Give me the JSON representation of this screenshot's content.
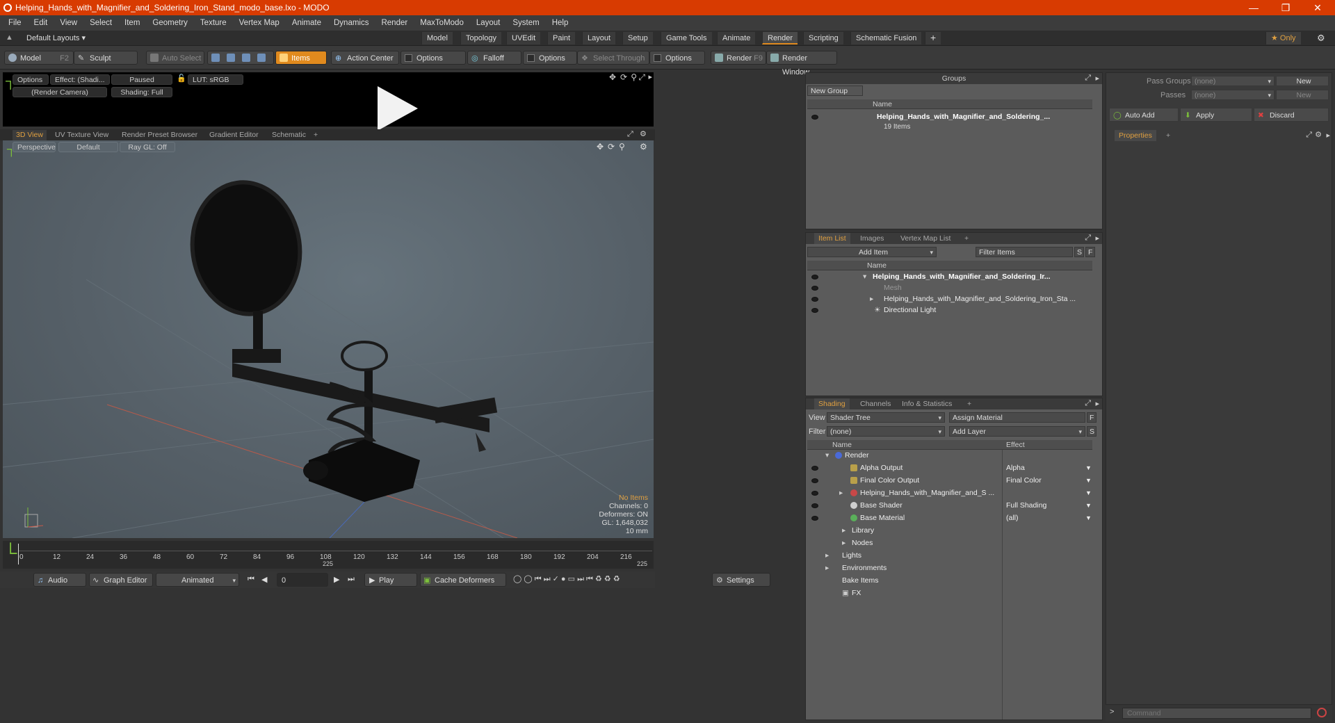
{
  "window": {
    "title": "Helping_Hands_with_Magnifier_and_Soldering_Iron_Stand_modo_base.lxo - MODO"
  },
  "menu": [
    "File",
    "Edit",
    "View",
    "Select",
    "Item",
    "Geometry",
    "Texture",
    "Vertex Map",
    "Animate",
    "Dynamics",
    "Render",
    "MaxToModo",
    "Layout",
    "System",
    "Help"
  ],
  "layouts": {
    "default": "Default Layouts ▾",
    "tabs": [
      "Model",
      "Topology",
      "UVEdit",
      "Paint",
      "Layout",
      "Setup",
      "Game Tools",
      "Animate",
      "Render",
      "Scripting",
      "Schematic Fusion"
    ],
    "active": "Render",
    "plus": "+",
    "only": "★ Only"
  },
  "toolbar": {
    "model": "Model",
    "model_key": "F2",
    "sculpt": "Sculpt",
    "auto_select": "Auto Select",
    "items": "Items",
    "action_center": "Action Center",
    "options1": "Options",
    "falloff": "Falloff",
    "options2": "Options",
    "select_through": "Select Through",
    "options3": "Options",
    "render": "Render",
    "render_key": "F9",
    "render_window": "Render Window"
  },
  "preview": {
    "options": "Options",
    "effect": "Effect: (Shadi...",
    "paused": "Paused",
    "lut": "LUT: sRGB",
    "camera": "(Render Camera)",
    "shading": "Shading: Full"
  },
  "viewport_tabs": [
    "3D View",
    "UV Texture View",
    "Render Preset Browser",
    "Gradient Editor",
    "Schematic",
    "+"
  ],
  "view3d": {
    "perspective": "Perspective",
    "default": "Default",
    "raygl": "Ray GL: Off",
    "hud": {
      "items": "No Items",
      "channels": "Channels: 0",
      "deformers": "Deformers: ON",
      "gl": "GL: 1,648,032",
      "unit": "10 mm"
    }
  },
  "timeline": {
    "ticks": [
      "0",
      "12",
      "24",
      "36",
      "48",
      "60",
      "72",
      "84",
      "96",
      "108",
      "120",
      "132",
      "144",
      "156",
      "168",
      "180",
      "192",
      "204",
      "216"
    ],
    "marker_mid": "225",
    "marker_end": "225"
  },
  "bottom": {
    "audio": "Audio",
    "graph_editor": "Graph Editor",
    "animated": "Animated",
    "frame": "0",
    "play": "Play",
    "cache": "Cache Deformers",
    "settings": "Settings"
  },
  "groups": {
    "title": "Groups",
    "new_group": "New Group",
    "col_name": "Name",
    "item_name": "Helping_Hands_with_Magnifier_and_Soldering_...",
    "item_count": "19 Items"
  },
  "itemlist": {
    "tabs": [
      "Item List",
      "Images",
      "Vertex Map List",
      "+"
    ],
    "add_item": "Add Item",
    "filter": "Filter Items",
    "s": "S",
    "f": "F",
    "col_name": "Name",
    "rows": [
      "Helping_Hands_with_Magnifier_and_Soldering_Ir...",
      "Mesh",
      "Helping_Hands_with_Magnifier_and_Soldering_Iron_Sta ...",
      "Directional Light"
    ]
  },
  "shading": {
    "tabs": [
      "Shading",
      "Channels",
      "Info & Statistics",
      "+"
    ],
    "view_label": "View",
    "view_value": "Shader Tree",
    "assign": "Assign Material",
    "f": "F",
    "filter_label": "Filter",
    "filter_value": "(none)",
    "add_layer": "Add Layer",
    "s": "S",
    "col_name": "Name",
    "col_effect": "Effect",
    "rows": [
      {
        "name": "Render",
        "effect": ""
      },
      {
        "name": "Alpha Output",
        "effect": "Alpha"
      },
      {
        "name": "Final Color Output",
        "effect": "Final Color"
      },
      {
        "name": "Helping_Hands_with_Magnifier_and_S ...",
        "effect": ""
      },
      {
        "name": "Base Shader",
        "effect": "Full Shading"
      },
      {
        "name": "Base Material",
        "effect": "(all)"
      },
      {
        "name": "Library",
        "effect": ""
      },
      {
        "name": "Nodes",
        "effect": ""
      },
      {
        "name": "Lights",
        "effect": ""
      },
      {
        "name": "Environments",
        "effect": ""
      },
      {
        "name": "Bake Items",
        "effect": ""
      },
      {
        "name": "FX",
        "effect": ""
      }
    ]
  },
  "passes": {
    "pass_groups": "Pass Groups",
    "pass_value": "(none)",
    "new": "New",
    "passes": "Passes",
    "passes_value": "(none)",
    "new2": "New",
    "auto_add": "Auto Add",
    "apply": "Apply",
    "discard": "Discard",
    "properties": "Properties",
    "plus": "+"
  },
  "command": {
    "placeholder": "Command",
    "prompt": ">"
  }
}
